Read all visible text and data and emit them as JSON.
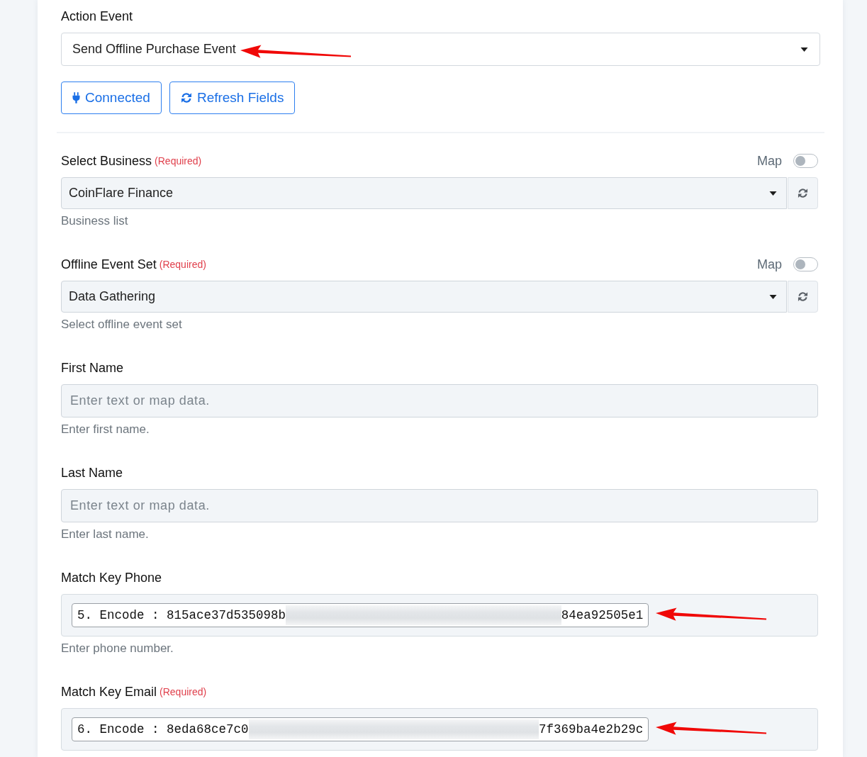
{
  "action_event": {
    "label": "Action Event",
    "value": "Send Offline Purchase Event",
    "arrow": true
  },
  "buttons": [
    {
      "kind": "plug",
      "label": "Connected"
    },
    {
      "kind": "refresh",
      "label": "Refresh Fields"
    }
  ],
  "fields": [
    {
      "kind": "select",
      "label": "Select Business",
      "required": "(Required)",
      "map_label": "Map",
      "map_on": false,
      "value": "CoinFlare Finance",
      "help": "Business list"
    },
    {
      "kind": "select",
      "label": "Offline Event Set",
      "required": "(Required)",
      "map_label": "Map",
      "map_on": false,
      "value": "Data Gathering",
      "help": "Select offline event set"
    },
    {
      "kind": "text",
      "label": "First Name",
      "placeholder": "Enter text or map data.",
      "help": "Enter first name."
    },
    {
      "kind": "text",
      "label": "Last Name",
      "placeholder": "Enter text or map data.",
      "help": "Enter last name."
    },
    {
      "kind": "token",
      "label": "Match Key Phone",
      "token_start": "5. Encode : 815ace37d535098b",
      "blurred": true,
      "token_end": "84ea92505e1",
      "arrow": true,
      "help": "Enter phone number."
    },
    {
      "kind": "token",
      "label": "Match Key Email",
      "required": "(Required)",
      "token_start": "6. Encode : 8eda68ce7c0",
      "blurred": true,
      "token_end": "7f369ba4e2b29c",
      "arrow": true
    }
  ]
}
